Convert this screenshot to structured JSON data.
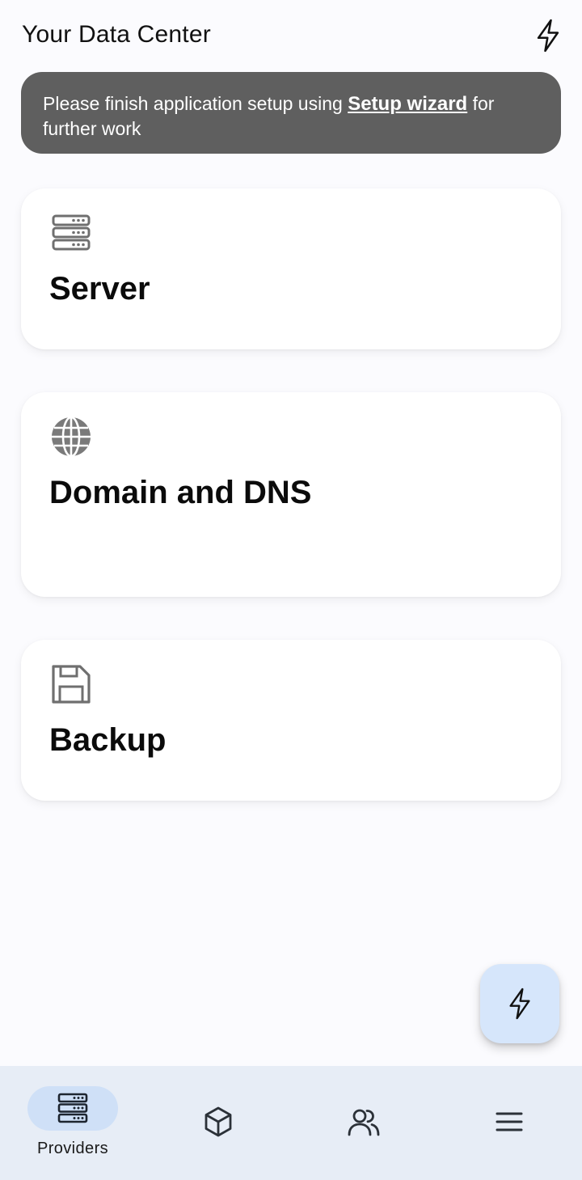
{
  "app_bar": {
    "title": "Your Data Center",
    "action_icon": "bolt-icon"
  },
  "banner": {
    "text_before": "Please finish application setup using ",
    "link_text": "Setup wizard",
    "text_after": " for further work"
  },
  "cards": [
    {
      "title": "Server",
      "icon": "server-icon"
    },
    {
      "title": "Domain and DNS",
      "icon": "globe-icon"
    },
    {
      "title": "Backup",
      "icon": "floppy-disk-icon"
    }
  ],
  "fab": {
    "icon": "bolt-icon"
  },
  "bottom_nav": {
    "items": [
      {
        "label": "Providers",
        "icon": "server-icon",
        "selected": true
      },
      {
        "label": "",
        "icon": "box-icon",
        "selected": false
      },
      {
        "label": "",
        "icon": "users-icon",
        "selected": false
      },
      {
        "label": "",
        "icon": "menu-icon",
        "selected": false
      }
    ]
  },
  "colors": {
    "background": "#fbfbfe",
    "banner": "#5f5f5f",
    "fab": "#d6e6fb",
    "nav_bar": "#e7edf6",
    "nav_selected_pill": "#cfe0f7",
    "card_icon": "#6f6f6f"
  }
}
